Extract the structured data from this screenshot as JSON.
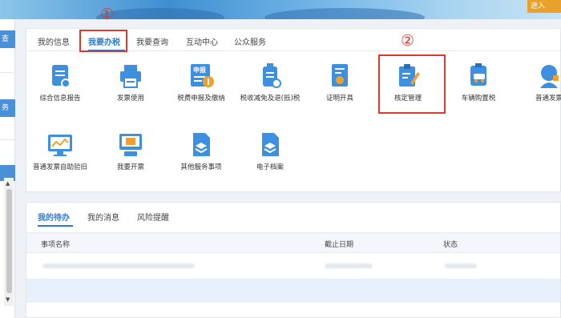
{
  "header": {
    "enter_button": "进入"
  },
  "sidebar": {
    "items": [
      "查",
      "务"
    ]
  },
  "tabs": [
    {
      "label": "我的信息"
    },
    {
      "label": "我要办税"
    },
    {
      "label": "我要查询"
    },
    {
      "label": "互动中心"
    },
    {
      "label": "公众服务"
    }
  ],
  "services_row1": [
    {
      "label": "综合信息报告",
      "icon": "report-icon"
    },
    {
      "label": "发票使用",
      "icon": "printer-icon"
    },
    {
      "label": "税费申报及缴纳",
      "icon": "declare-icon",
      "badge": "申报"
    },
    {
      "label": "税收减免及退(抵)税",
      "icon": "tax-refund-icon"
    },
    {
      "label": "证明开具",
      "icon": "certificate-icon"
    },
    {
      "label": "核定管理",
      "icon": "edit-clipboard-icon"
    },
    {
      "label": "车辆购置税",
      "icon": "car-icon"
    },
    {
      "label": "普通发票",
      "icon": "support-icon"
    }
  ],
  "services_row2": [
    {
      "label": "普通发票自助验旧",
      "icon": "monitor-chart-icon"
    },
    {
      "label": "我要开票",
      "icon": "terminal-icon"
    },
    {
      "label": "其他服务事项",
      "icon": "document-stack-icon"
    },
    {
      "label": "电子档案",
      "icon": "archive-icon"
    }
  ],
  "annotations": {
    "step1": "①",
    "step2": "②"
  },
  "bottom_tabs": [
    {
      "label": "我的待办"
    },
    {
      "label": "我的消息"
    },
    {
      "label": "风险提醒"
    }
  ],
  "table": {
    "headers": [
      "事项名称",
      "截止日期",
      "状态"
    ]
  },
  "colors": {
    "accent": "#2b7bd6",
    "highlight": "#e0382b",
    "icon_blue": "#3d8fe0"
  }
}
